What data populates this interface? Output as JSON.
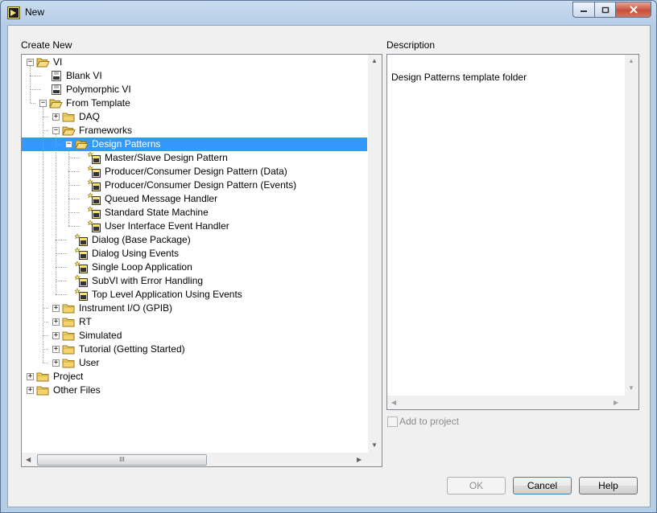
{
  "window": {
    "title": "New",
    "min_icon": "minimize-icon",
    "max_icon": "maximize-icon",
    "close_icon": "close-icon"
  },
  "left_panel": {
    "label": "Create New"
  },
  "tree": [
    {
      "label": "VI",
      "icon": "folder-open-icon",
      "expander": "minus"
    },
    {
      "label": "Blank VI",
      "icon": "vi-icon",
      "expander": ""
    },
    {
      "label": "Polymorphic VI",
      "icon": "vi-icon",
      "expander": ""
    },
    {
      "label": "From Template",
      "icon": "folder-open-icon",
      "expander": "minus"
    },
    {
      "label": "DAQ",
      "icon": "folder-icon",
      "expander": "plus"
    },
    {
      "label": "Frameworks",
      "icon": "folder-open-icon",
      "expander": "minus"
    },
    {
      "label": "Design Patterns",
      "icon": "folder-open-icon",
      "expander": "minus",
      "selected": true
    },
    {
      "label": "Master/Slave Design Pattern",
      "icon": "template-icon",
      "expander": ""
    },
    {
      "label": "Producer/Consumer Design Pattern (Data)",
      "icon": "template-icon",
      "expander": ""
    },
    {
      "label": "Producer/Consumer Design Pattern (Events)",
      "icon": "template-icon",
      "expander": ""
    },
    {
      "label": "Queued Message Handler",
      "icon": "template-icon",
      "expander": ""
    },
    {
      "label": "Standard State Machine",
      "icon": "template-icon",
      "expander": ""
    },
    {
      "label": "User Interface Event Handler",
      "icon": "template-icon",
      "expander": ""
    },
    {
      "label": "Dialog (Base Package)",
      "icon": "template-icon",
      "expander": ""
    },
    {
      "label": "Dialog Using Events",
      "icon": "template-icon",
      "expander": ""
    },
    {
      "label": "Single Loop Application",
      "icon": "template-icon",
      "expander": ""
    },
    {
      "label": "SubVI with Error Handling",
      "icon": "template-icon",
      "expander": ""
    },
    {
      "label": "Top Level Application Using Events",
      "icon": "template-icon",
      "expander": ""
    },
    {
      "label": "Instrument I/O (GPIB)",
      "icon": "folder-icon",
      "expander": "plus"
    },
    {
      "label": "RT",
      "icon": "folder-icon",
      "expander": "plus"
    },
    {
      "label": "Simulated",
      "icon": "folder-icon",
      "expander": "plus"
    },
    {
      "label": "Tutorial (Getting Started)",
      "icon": "folder-icon",
      "expander": "plus"
    },
    {
      "label": "User",
      "icon": "folder-icon",
      "expander": "plus"
    },
    {
      "label": "Project",
      "icon": "folder-icon",
      "expander": "plus"
    },
    {
      "label": "Other Files",
      "icon": "folder-icon",
      "expander": "plus"
    }
  ],
  "description": {
    "label": "Description",
    "text": "Design Patterns template folder"
  },
  "add_to_project": {
    "label": "Add to project",
    "checked": false,
    "enabled": false
  },
  "buttons": {
    "ok": "OK",
    "cancel": "Cancel",
    "help": "Help"
  },
  "scrollbar": {
    "grip": "III"
  }
}
